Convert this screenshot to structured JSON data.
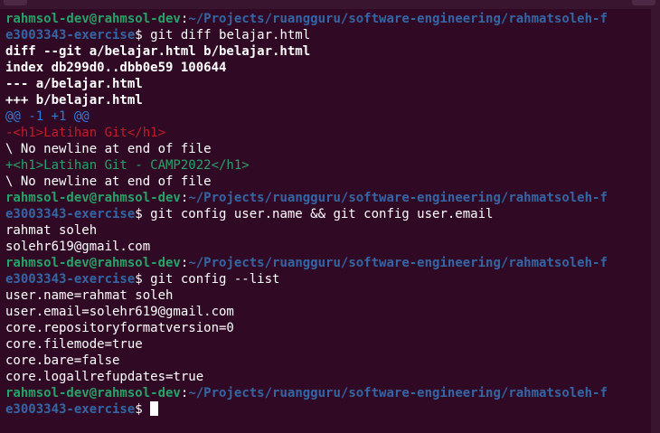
{
  "colors": {
    "background": "#300a24",
    "prompt_user": "#26a269",
    "prompt_path": "#3465a4",
    "diff_hunk": "#2a7bde",
    "diff_removed": "#c01c28",
    "diff_added": "#26a269"
  },
  "terminal": {
    "lines": [
      {
        "kind": "prompt",
        "user": "rahmsol-dev@rahmsol-dev",
        "sep": ":",
        "path": "~/Projects/ruangguru/software-engineering/rahmatsoleh-f"
      },
      {
        "kind": "prompt_cont",
        "path": "e3003343-exercise",
        "dollar": "$",
        "command": " git diff belajar.html"
      },
      {
        "kind": "bold",
        "text": "diff --git a/belajar.html b/belajar.html"
      },
      {
        "kind": "bold",
        "text": "index db299d0..dbb0e59 100644"
      },
      {
        "kind": "bold",
        "text": "--- a/belajar.html"
      },
      {
        "kind": "bold",
        "text": "+++ b/belajar.html"
      },
      {
        "kind": "hunk",
        "text": "@@ -1 +1 @@"
      },
      {
        "kind": "del",
        "text": "-<h1>Latihan Git</h1>"
      },
      {
        "kind": "plain",
        "text": "\\ No newline at end of file"
      },
      {
        "kind": "add",
        "text": "+<h1>Latihan Git - CAMP2022</h1>"
      },
      {
        "kind": "plain",
        "text": "\\ No newline at end of file"
      },
      {
        "kind": "prompt",
        "user": "rahmsol-dev@rahmsol-dev",
        "sep": ":",
        "path": "~/Projects/ruangguru/software-engineering/rahmatsoleh-f"
      },
      {
        "kind": "prompt_cont",
        "path": "e3003343-exercise",
        "dollar": "$",
        "command": " git config user.name && git config user.email"
      },
      {
        "kind": "plain",
        "text": "rahmat soleh"
      },
      {
        "kind": "plain",
        "text": "solehr619@gmail.com"
      },
      {
        "kind": "prompt",
        "user": "rahmsol-dev@rahmsol-dev",
        "sep": ":",
        "path": "~/Projects/ruangguru/software-engineering/rahmatsoleh-f"
      },
      {
        "kind": "prompt_cont",
        "path": "e3003343-exercise",
        "dollar": "$",
        "command": " git config --list"
      },
      {
        "kind": "plain",
        "text": "user.name=rahmat soleh"
      },
      {
        "kind": "plain",
        "text": "user.email=solehr619@gmail.com"
      },
      {
        "kind": "plain",
        "text": "core.repositoryformatversion=0"
      },
      {
        "kind": "plain",
        "text": "core.filemode=true"
      },
      {
        "kind": "plain",
        "text": "core.bare=false"
      },
      {
        "kind": "plain",
        "text": "core.logallrefupdates=true"
      },
      {
        "kind": "prompt",
        "user": "rahmsol-dev@rahmsol-dev",
        "sep": ":",
        "path": "~/Projects/ruangguru/software-engineering/rahmatsoleh-f"
      },
      {
        "kind": "prompt_cont",
        "path": "e3003343-exercise",
        "dollar": "$",
        "command": " ",
        "cursor": true
      }
    ]
  }
}
